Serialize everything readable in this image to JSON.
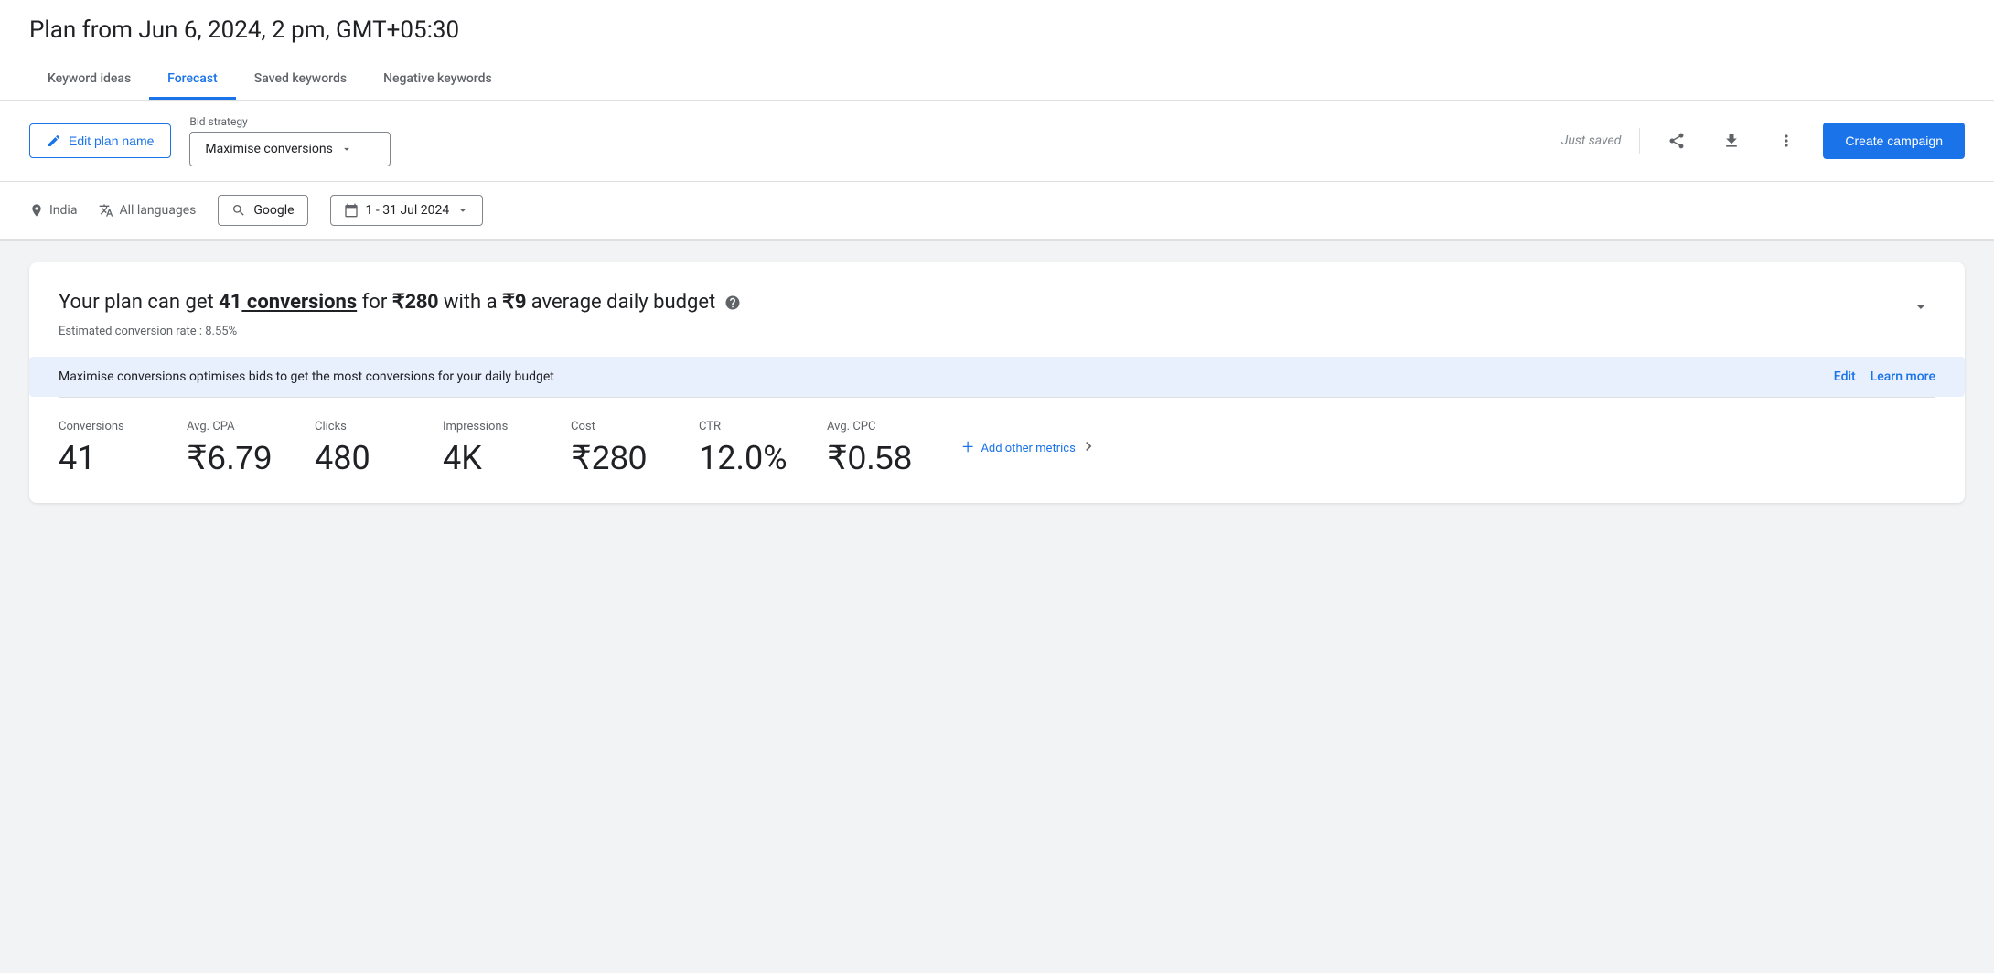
{
  "header": {
    "plan_title": "Plan from Jun 6, 2024, 2 pm, GMT+05:30"
  },
  "tabs": [
    {
      "id": "keyword-ideas",
      "label": "Keyword ideas",
      "active": false
    },
    {
      "id": "forecast",
      "label": "Forecast",
      "active": true
    },
    {
      "id": "saved-keywords",
      "label": "Saved keywords",
      "active": false
    },
    {
      "id": "negative-keywords",
      "label": "Negative keywords",
      "active": false
    }
  ],
  "toolbar": {
    "edit_plan_label": "Edit plan name",
    "bid_strategy_label": "Bid strategy",
    "bid_strategy_value": "Maximise conversions",
    "just_saved_text": "Just saved",
    "create_campaign_label": "Create campaign",
    "share_icon": "↑",
    "download_icon": "↓",
    "more_icon": "⋮"
  },
  "filters": {
    "location_label": "India",
    "language_label": "All languages",
    "network_label": "Google",
    "date_range_label": "1 - 31 Jul 2024"
  },
  "summary": {
    "prefix": "Your plan can get ",
    "conversions_count": "41",
    "conversions_label": " conversions",
    "middle_text": " for ",
    "cost": "₹280",
    "with_text": " with a ",
    "daily_budget": "₹9",
    "suffix": " average daily budget",
    "conversion_rate_label": "Estimated conversion rate : 8.55%",
    "info_banner_text": "Maximise conversions optimises bids to get the most conversions for your daily budget",
    "edit_label": "Edit",
    "learn_more_label": "Learn more"
  },
  "metrics": [
    {
      "id": "conversions",
      "label": "Conversions",
      "value": "41"
    },
    {
      "id": "avg-cpa",
      "label": "Avg. CPA",
      "value": "₹6.79"
    },
    {
      "id": "clicks",
      "label": "Clicks",
      "value": "480"
    },
    {
      "id": "impressions",
      "label": "Impressions",
      "value": "4K"
    },
    {
      "id": "cost",
      "label": "Cost",
      "value": "₹280"
    },
    {
      "id": "ctr",
      "label": "CTR",
      "value": "12.0%"
    },
    {
      "id": "avg-cpc",
      "label": "Avg. CPC",
      "value": "₹0.58"
    }
  ],
  "add_metrics": {
    "label": "Add other metrics",
    "icon": "+"
  }
}
